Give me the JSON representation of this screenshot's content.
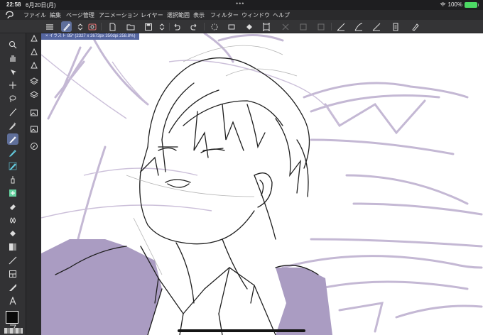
{
  "status": {
    "time": "22:58",
    "date": "6月20日(月)",
    "dots": "•••",
    "battery": "100%"
  },
  "menu": {
    "items": [
      "ファイル",
      "編集",
      "ページ管理",
      "アニメーション",
      "レイヤー",
      "選択範囲",
      "表示",
      "フィルター",
      "ウィンドウ",
      "ヘルプ"
    ]
  },
  "canvas": {
    "tab_label": "× イラスト 85* (2327 x 2673px 350dpi 258.8%)"
  },
  "colors": {
    "accent": "#5f6f9a",
    "tab": "#5566a0",
    "draft": "#bfb3ce",
    "fill": "#a99bc0",
    "line": "#1a1a1a"
  },
  "icons": {
    "toolbar": [
      "menu-icon",
      "brush-tool-icon",
      "chevron-updown-icon",
      "cloud-sync-icon",
      "new-file-icon",
      "open-folder-icon",
      "save-icon",
      "chevron-updown-icon",
      "undo-icon",
      "redo-icon",
      "loading-icon",
      "fill-bucket-icon",
      "crop-icon",
      "transform-icon",
      "grid-icon",
      "square-icon",
      "ruler-icon",
      "ruler-curve-icon",
      "ruler-icon",
      "page-icon",
      "settings-pen-icon"
    ],
    "tools": [
      "zoom-icon",
      "hand-icon",
      "rotate-icon",
      "move-icon",
      "lasso-icon",
      "magic-wand-icon",
      "eyedropper-icon",
      "pen-icon",
      "pencil-icon",
      "brush-icon",
      "airbrush-icon",
      "decoration-icon",
      "eraser-icon",
      "blend-icon",
      "fill-icon",
      "gradient-icon",
      "line-icon",
      "frame-icon",
      "ruler-icon",
      "text-icon",
      "balloon-icon",
      "correction-icon"
    ]
  }
}
